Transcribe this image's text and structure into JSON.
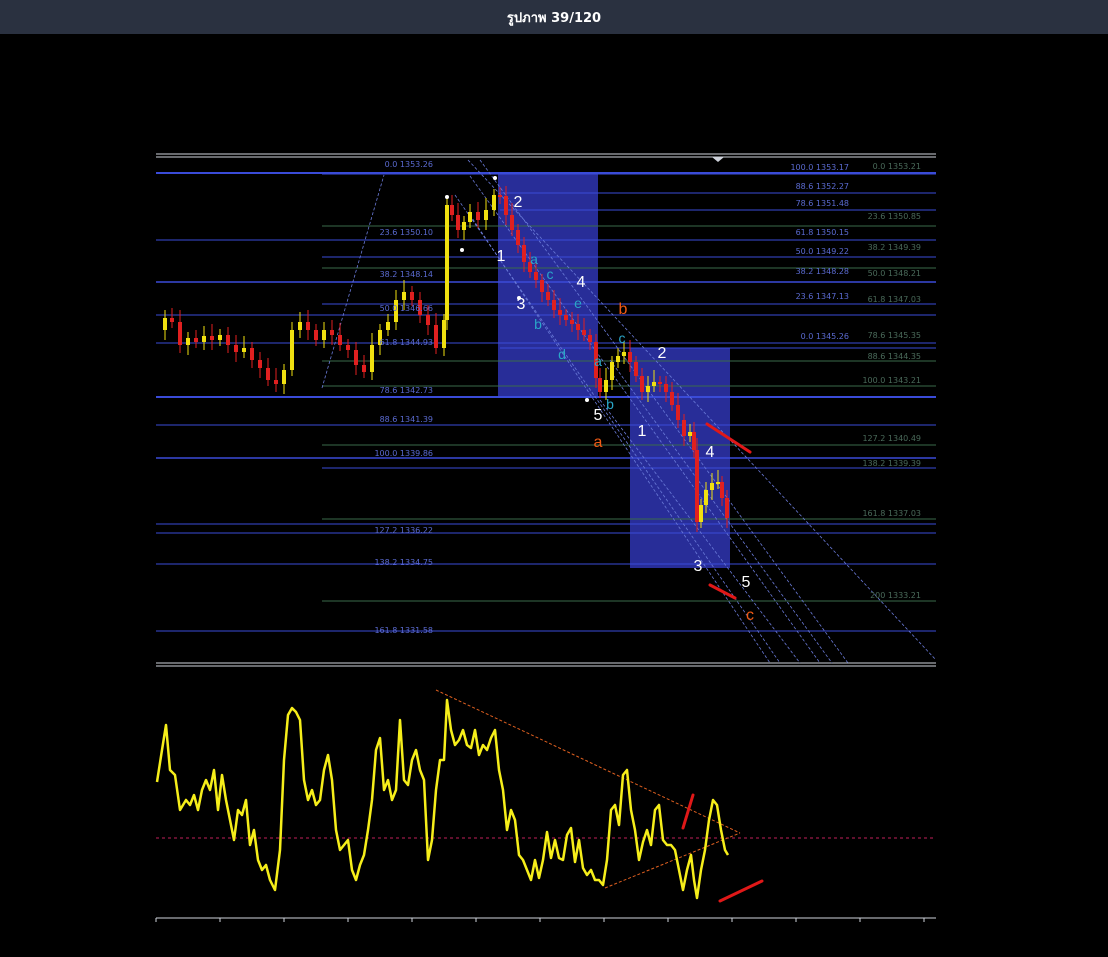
{
  "viewer": {
    "counter": "รูปภาพ 39/120"
  },
  "colors": {
    "background": "#000000",
    "topbar": "#2a3140",
    "fib_line": "#3a4bd8",
    "box": "#2a2fa0",
    "candle_up": "#f0e010",
    "candle_down": "#e02020",
    "oscillator": "#f6ee1a",
    "wave_white": "#ffffff",
    "wave_cyan": "#2aa6c8",
    "wave_orange": "#f05a14",
    "red_mark": "#e01818"
  },
  "fib_left": [
    "0.0 1353.26",
    "23.6 1350.10",
    "38.2 1348.14",
    "50.0 1346.66",
    "61.8 1344.93",
    "78.6 1342.73",
    "88.6 1341.39",
    "100.0 1339.86",
    "127.2 1336.22",
    "138.2 1334.75",
    "161.8 1331.58"
  ],
  "fib_mid": [
    "100.0 1353.17",
    "88.6 1352.27",
    "78.6 1351.48",
    "61.8 1350.15",
    "50.0 1349.22",
    "38.2 1348.28",
    "23.6 1347.13",
    "0.0 1345.26"
  ],
  "fib_right": [
    "0.0 1353.21",
    "23.6 1350.85",
    "38.2 1349.39",
    "50.0 1348.21",
    "61.8 1347.03",
    "78.6 1345.35",
    "88.6 1344.35",
    "100.0 1343.21",
    "127.2 1340.49",
    "138.2 1339.39",
    "161.8 1337.03",
    "200 1333.21"
  ],
  "waves": {
    "white": [
      "1",
      "2",
      "3",
      "4",
      "5",
      "1",
      "2",
      "4",
      "3",
      "5"
    ],
    "cyan": [
      "a",
      "c",
      "e",
      "b",
      "d",
      "a",
      "b",
      "c"
    ],
    "orange": [
      "b",
      "a",
      "c"
    ]
  }
}
